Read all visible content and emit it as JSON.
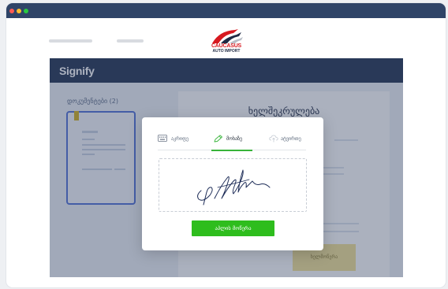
{
  "window": {
    "title_dots": [
      "close",
      "minimize",
      "maximize"
    ]
  },
  "site": {
    "logo_line1": "CAUCASUS",
    "logo_line2": "AUTO IMPORT",
    "nav_items": 2
  },
  "app": {
    "brand": "Signify",
    "sidebar": {
      "documents_label": "დოკუმენტები (2)"
    },
    "document": {
      "title": "ხელშეკრულება",
      "sign_button": "ხელმოწერა"
    }
  },
  "modal": {
    "tabs": [
      {
        "label": "აკრიფე",
        "icon": "keyboard-icon",
        "active": false
      },
      {
        "label": "მოხაზე",
        "icon": "pen-icon",
        "active": true
      },
      {
        "label": "ატვირთე",
        "icon": "upload-icon",
        "active": false
      }
    ],
    "submit_label": "აპლის მოწერა"
  },
  "colors": {
    "header": "#1f3150",
    "accent_green": "#2ebd1d",
    "selection_blue": "#4e6fd6",
    "logo_red": "#d71920"
  }
}
